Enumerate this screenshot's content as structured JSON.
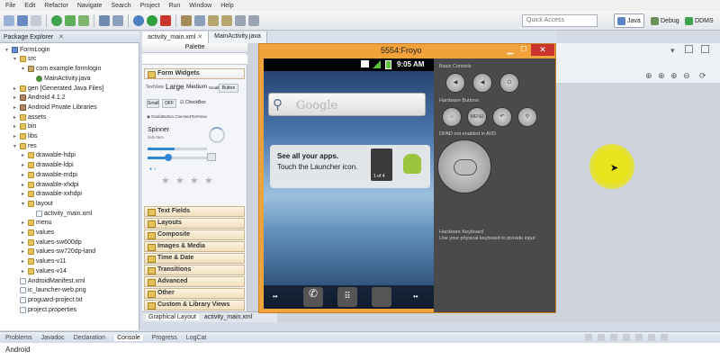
{
  "menu": [
    "File",
    "Edit",
    "Refactor",
    "Navigate",
    "Search",
    "Project",
    "Run",
    "Window",
    "Help"
  ],
  "toolbar": {
    "quick_access_placeholder": "Quick Access",
    "perspectives": [
      "Java",
      "Debug",
      "DDMS"
    ]
  },
  "package_explorer": {
    "title": "Package Explorer",
    "tree": [
      {
        "label": "FormLogin",
        "level": 0,
        "icon": "project",
        "expanded": true
      },
      {
        "label": "src",
        "level": 1,
        "icon": "folder",
        "expanded": true
      },
      {
        "label": "com.example.formlogin",
        "level": 2,
        "icon": "package",
        "expanded": true
      },
      {
        "label": "MainActivity.java",
        "level": 3,
        "icon": "java"
      },
      {
        "label": "gen [Generated Java Files]",
        "level": 1,
        "icon": "folder"
      },
      {
        "label": "Android 4.1.2",
        "level": 1,
        "icon": "library"
      },
      {
        "label": "Android Private Libraries",
        "level": 1,
        "icon": "library"
      },
      {
        "label": "assets",
        "level": 1,
        "icon": "folder"
      },
      {
        "label": "bin",
        "level": 1,
        "icon": "folder"
      },
      {
        "label": "libs",
        "level": 1,
        "icon": "folder"
      },
      {
        "label": "res",
        "level": 1,
        "icon": "folder",
        "expanded": true
      },
      {
        "label": "drawable-hdpi",
        "level": 2,
        "icon": "folder"
      },
      {
        "label": "drawable-ldpi",
        "level": 2,
        "icon": "folder"
      },
      {
        "label": "drawable-mdpi",
        "level": 2,
        "icon": "folder"
      },
      {
        "label": "drawable-xhdpi",
        "level": 2,
        "icon": "folder"
      },
      {
        "label": "drawable-xxhdpi",
        "level": 2,
        "icon": "folder"
      },
      {
        "label": "layout",
        "level": 2,
        "icon": "folder",
        "expanded": true
      },
      {
        "label": "activity_main.xml",
        "level": 3,
        "icon": "file"
      },
      {
        "label": "menu",
        "level": 2,
        "icon": "folder"
      },
      {
        "label": "values",
        "level": 2,
        "icon": "folder"
      },
      {
        "label": "values-sw600dp",
        "level": 2,
        "icon": "folder"
      },
      {
        "label": "values-sw720dp-land",
        "level": 2,
        "icon": "folder"
      },
      {
        "label": "values-v11",
        "level": 2,
        "icon": "folder"
      },
      {
        "label": "values-v14",
        "level": 2,
        "icon": "folder"
      },
      {
        "label": "AndroidManifest.xml",
        "level": 1,
        "icon": "file"
      },
      {
        "label": "ic_launcher-web.png",
        "level": 1,
        "icon": "file"
      },
      {
        "label": "proguard-project.txt",
        "level": 1,
        "icon": "file"
      },
      {
        "label": "project.properties",
        "level": 1,
        "icon": "file"
      }
    ]
  },
  "editor": {
    "tabs": [
      "activity_main.xml",
      "MainActivity.java"
    ],
    "palette_title": "Palette",
    "form_widgets": "Form Widgets",
    "text_sizes": [
      "TextView",
      "Large",
      "Medium",
      "Small",
      "Button"
    ],
    "toggles": [
      "Small",
      "OFF",
      "CheckBox"
    ],
    "radio_label": "RadioButton CheckedTextView",
    "spinner_label": "Spinner",
    "spinner_sub": "Sub Item",
    "categories": [
      "Text Fields",
      "Layouts",
      "Composite",
      "Images & Media",
      "Time & Date",
      "Transitions",
      "Advanced",
      "Other",
      "Custom & Library Views"
    ],
    "bottom_tabs": [
      "Graphical Layout",
      "activity_main.xml"
    ]
  },
  "emulator": {
    "title": "5554:Froyo",
    "clock": "9:05 AM",
    "search_placeholder": "Google",
    "tip_line1": "See all your apps.",
    "tip_line2": "Touch the Launcher icon.",
    "tip_count": "1 of 4",
    "basic_controls": "Basic Controls",
    "hardware_buttons": "Hardware Buttons",
    "dpad_note": "DPAD not enabled in AVD",
    "hw_keyboard": "Hardware Keyboard",
    "hw_keyboard_note": "Use your physical keyboard to provide input",
    "menu_button": "MENU"
  },
  "console": {
    "tabs": [
      "Problems",
      "Javadoc",
      "Declaration",
      "Console",
      "Progress",
      "LogCat"
    ],
    "active_tab": "Console",
    "content": "Android"
  },
  "colors": {
    "emulator_frame": "#f2a23a",
    "close_button": "#c9352c",
    "cursor_highlight": "#e8e31a"
  }
}
